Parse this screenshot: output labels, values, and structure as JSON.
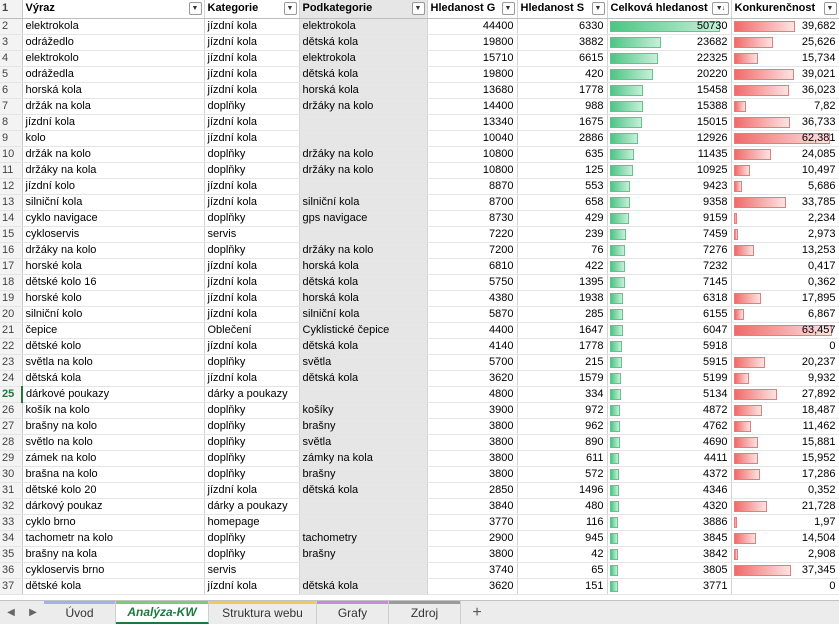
{
  "headers": [
    {
      "label": "Výraz",
      "filter": "▼"
    },
    {
      "label": "Kategorie",
      "filter": "▼"
    },
    {
      "label": "Podkategorie",
      "filter": "▼"
    },
    {
      "label": "Hledanost G",
      "filter": "▼"
    },
    {
      "label": "Hledanost S",
      "filter": "▼"
    },
    {
      "label": "Celková hledanost",
      "filter": "▼↓"
    },
    {
      "label": "Konkurenčnost",
      "filter": "▼"
    }
  ],
  "header_row_number": "1",
  "active_row": "25",
  "colors": {
    "bar_green": "#4cc585",
    "bar_red": "#f06a6a",
    "accent": "#1e7a3c"
  },
  "max_total": 50730,
  "max_comp": 63.457,
  "rows": [
    {
      "n": "2",
      "a": "elektrokola",
      "b": "jízdní kola",
      "c": "elektrokola",
      "d": "44400",
      "e": "6330",
      "f": "50730",
      "g": "39,682",
      "fv": 50730,
      "gv": 39.682
    },
    {
      "n": "3",
      "a": "odrážedlo",
      "b": "jízdní kola",
      "c": "dětská kola",
      "d": "19800",
      "e": "3882",
      "f": "23682",
      "g": "25,626",
      "fv": 23682,
      "gv": 25.626
    },
    {
      "n": "4",
      "a": "elektrokolo",
      "b": "jízdní kola",
      "c": "elektrokola",
      "d": "15710",
      "e": "6615",
      "f": "22325",
      "g": "15,734",
      "fv": 22325,
      "gv": 15.734
    },
    {
      "n": "5",
      "a": "odrážedla",
      "b": "jízdní kola",
      "c": "dětská kola",
      "d": "19800",
      "e": "420",
      "f": "20220",
      "g": "39,021",
      "fv": 20220,
      "gv": 39.021
    },
    {
      "n": "6",
      "a": "horská kola",
      "b": "jízdní kola",
      "c": "horská kola",
      "d": "13680",
      "e": "1778",
      "f": "15458",
      "g": "36,023",
      "fv": 15458,
      "gv": 36.023
    },
    {
      "n": "7",
      "a": "držák na kola",
      "b": "doplňky",
      "c": "držáky na kolo",
      "d": "14400",
      "e": "988",
      "f": "15388",
      "g": "7,82",
      "fv": 15388,
      "gv": 7.82
    },
    {
      "n": "8",
      "a": "jízdní kola",
      "b": "jízdní kola",
      "c": "",
      "d": "13340",
      "e": "1675",
      "f": "15015",
      "g": "36,733",
      "fv": 15015,
      "gv": 36.733
    },
    {
      "n": "9",
      "a": "kolo",
      "b": "jízdní kola",
      "c": "",
      "d": "10040",
      "e": "2886",
      "f": "12926",
      "g": "62,381",
      "fv": 12926,
      "gv": 62.381
    },
    {
      "n": "10",
      "a": "držák na kolo",
      "b": "doplňky",
      "c": "držáky na kolo",
      "d": "10800",
      "e": "635",
      "f": "11435",
      "g": "24,085",
      "fv": 11435,
      "gv": 24.085
    },
    {
      "n": "11",
      "a": "držáky na kola",
      "b": "doplňky",
      "c": "držáky na kolo",
      "d": "10800",
      "e": "125",
      "f": "10925",
      "g": "10,497",
      "fv": 10925,
      "gv": 10.497
    },
    {
      "n": "12",
      "a": "jízdní kolo",
      "b": "jízdní kola",
      "c": "",
      "d": "8870",
      "e": "553",
      "f": "9423",
      "g": "5,686",
      "fv": 9423,
      "gv": 5.686
    },
    {
      "n": "13",
      "a": "silniční kola",
      "b": "jízdní kola",
      "c": "silniční kola",
      "d": "8700",
      "e": "658",
      "f": "9358",
      "g": "33,785",
      "fv": 9358,
      "gv": 33.785
    },
    {
      "n": "14",
      "a": "cyklo navigace",
      "b": "doplňky",
      "c": "gps navigace",
      "d": "8730",
      "e": "429",
      "f": "9159",
      "g": "2,234",
      "fv": 9159,
      "gv": 2.234
    },
    {
      "n": "15",
      "a": "cykloservis",
      "b": "servis",
      "c": "",
      "d": "7220",
      "e": "239",
      "f": "7459",
      "g": "2,973",
      "fv": 7459,
      "gv": 2.973
    },
    {
      "n": "16",
      "a": "držáky na kolo",
      "b": "doplňky",
      "c": "držáky na kolo",
      "d": "7200",
      "e": "76",
      "f": "7276",
      "g": "13,253",
      "fv": 7276,
      "gv": 13.253
    },
    {
      "n": "17",
      "a": "horské kola",
      "b": "jízdní kola",
      "c": "horská kola",
      "d": "6810",
      "e": "422",
      "f": "7232",
      "g": "0,417",
      "fv": 7232,
      "gv": 0.417
    },
    {
      "n": "18",
      "a": "dětské kolo 16",
      "b": "jízdní kola",
      "c": "dětská kola",
      "d": "5750",
      "e": "1395",
      "f": "7145",
      "g": "0,362",
      "fv": 7145,
      "gv": 0.362
    },
    {
      "n": "19",
      "a": "horské kolo",
      "b": "jízdní kola",
      "c": "horská kola",
      "d": "4380",
      "e": "1938",
      "f": "6318",
      "g": "17,895",
      "fv": 6318,
      "gv": 17.895
    },
    {
      "n": "20",
      "a": "silniční kolo",
      "b": "jízdní kola",
      "c": "silniční kola",
      "d": "5870",
      "e": "285",
      "f": "6155",
      "g": "6,867",
      "fv": 6155,
      "gv": 6.867
    },
    {
      "n": "21",
      "a": "čepice",
      "b": "Oblečení",
      "c": "Cyklistické čepice",
      "d": "4400",
      "e": "1647",
      "f": "6047",
      "g": "63,457",
      "fv": 6047,
      "gv": 63.457
    },
    {
      "n": "22",
      "a": "dětské kolo",
      "b": "jízdní kola",
      "c": "dětská kola",
      "d": "4140",
      "e": "1778",
      "f": "5918",
      "g": "0",
      "fv": 5918,
      "gv": 0
    },
    {
      "n": "23",
      "a": "světla na kolo",
      "b": "doplňky",
      "c": "světla",
      "d": "5700",
      "e": "215",
      "f": "5915",
      "g": "20,237",
      "fv": 5915,
      "gv": 20.237
    },
    {
      "n": "24",
      "a": "dětská kola",
      "b": "jízdní kola",
      "c": "dětská kola",
      "d": "3620",
      "e": "1579",
      "f": "5199",
      "g": "9,932",
      "fv": 5199,
      "gv": 9.932
    },
    {
      "n": "25",
      "a": "dárkové poukazy",
      "b": "dárky a poukazy",
      "c": "",
      "d": "4800",
      "e": "334",
      "f": "5134",
      "g": "27,892",
      "fv": 5134,
      "gv": 27.892
    },
    {
      "n": "26",
      "a": "košík na kolo",
      "b": "doplňky",
      "c": "košíky",
      "d": "3900",
      "e": "972",
      "f": "4872",
      "g": "18,487",
      "fv": 4872,
      "gv": 18.487
    },
    {
      "n": "27",
      "a": "brašny na kolo",
      "b": "doplňky",
      "c": "brašny",
      "d": "3800",
      "e": "962",
      "f": "4762",
      "g": "11,462",
      "fv": 4762,
      "gv": 11.462
    },
    {
      "n": "28",
      "a": "světlo na kolo",
      "b": "doplňky",
      "c": "světla",
      "d": "3800",
      "e": "890",
      "f": "4690",
      "g": "15,881",
      "fv": 4690,
      "gv": 15.881
    },
    {
      "n": "29",
      "a": "zámek na kolo",
      "b": "doplňky",
      "c": "zámky na kola",
      "d": "3800",
      "e": "611",
      "f": "4411",
      "g": "15,952",
      "fv": 4411,
      "gv": 15.952
    },
    {
      "n": "30",
      "a": "brašna na kolo",
      "b": "doplňky",
      "c": "brašny",
      "d": "3800",
      "e": "572",
      "f": "4372",
      "g": "17,286",
      "fv": 4372,
      "gv": 17.286
    },
    {
      "n": "31",
      "a": "dětské kolo 20",
      "b": "jízdní kola",
      "c": "dětská kola",
      "d": "2850",
      "e": "1496",
      "f": "4346",
      "g": "0,352",
      "fv": 4346,
      "gv": 0.352
    },
    {
      "n": "32",
      "a": "dárkový poukaz",
      "b": "dárky a poukazy",
      "c": "",
      "d": "3840",
      "e": "480",
      "f": "4320",
      "g": "21,728",
      "fv": 4320,
      "gv": 21.728
    },
    {
      "n": "33",
      "a": "cyklo brno",
      "b": "homepage",
      "c": "",
      "d": "3770",
      "e": "116",
      "f": "3886",
      "g": "1,97",
      "fv": 3886,
      "gv": 1.97
    },
    {
      "n": "34",
      "a": "tachometr na kolo",
      "b": "doplňky",
      "c": "tachometry",
      "d": "2900",
      "e": "945",
      "f": "3845",
      "g": "14,504",
      "fv": 3845,
      "gv": 14.504
    },
    {
      "n": "35",
      "a": "brašny na kola",
      "b": "doplňky",
      "c": "brašny",
      "d": "3800",
      "e": "42",
      "f": "3842",
      "g": "2,908",
      "fv": 3842,
      "gv": 2.908
    },
    {
      "n": "36",
      "a": "cykloservis brno",
      "b": "servis",
      "c": "",
      "d": "3740",
      "e": "65",
      "f": "3805",
      "g": "37,345",
      "fv": 3805,
      "gv": 37.345
    },
    {
      "n": "37",
      "a": "dětské kola",
      "b": "jízdní kola",
      "c": "dětská kola",
      "d": "3620",
      "e": "151",
      "f": "3771",
      "g": "0",
      "fv": 3771,
      "gv": 0
    }
  ],
  "tabs": [
    {
      "label": "Úvod",
      "stripe": "#9fb3e6",
      "active": false
    },
    {
      "label": "Analýza-KW",
      "stripe": "#7fc97f",
      "active": true
    },
    {
      "label": "Struktura webu",
      "stripe": "#f2c85a",
      "active": false
    },
    {
      "label": "Grafy",
      "stripe": "#c58ad8",
      "active": false
    },
    {
      "label": "Zdroj",
      "stripe": "#9a9a9a",
      "active": false
    }
  ],
  "nav": {
    "prev": "◀",
    "next": "▶",
    "add": "+"
  }
}
